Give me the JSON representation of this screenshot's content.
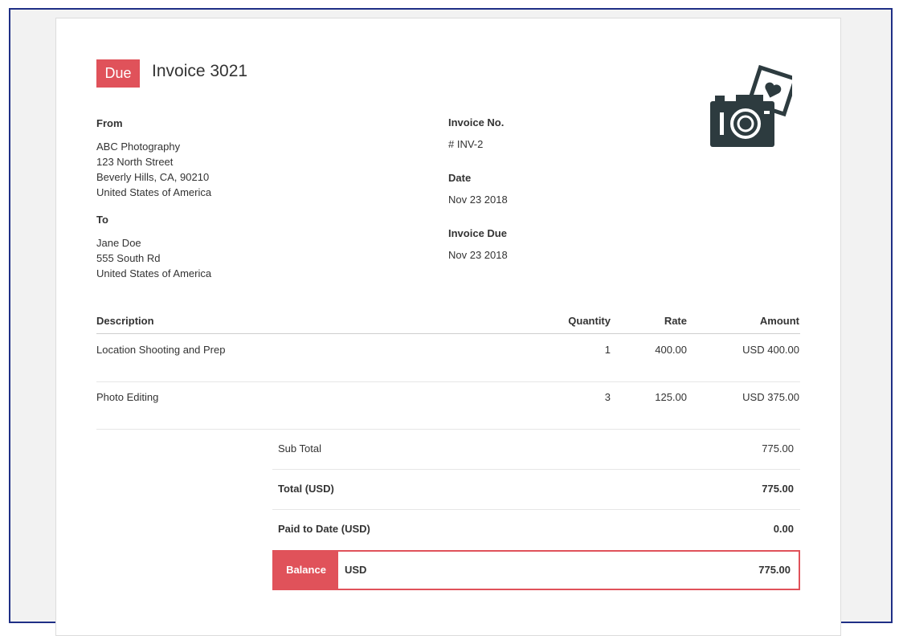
{
  "invoice": {
    "status": "Due",
    "title": "Invoice 3021",
    "logo_icon": "camera-photo-heart-icon"
  },
  "from": {
    "label": "From",
    "lines": [
      "ABC Photography",
      "123 North Street",
      "Beverly Hills, CA, 90210",
      "United States of America"
    ]
  },
  "to": {
    "label": "To",
    "lines": [
      "Jane Doe",
      "555 South Rd",
      "United States of America"
    ]
  },
  "meta": {
    "invoice_no_label": "Invoice No.",
    "invoice_no": "# INV-2",
    "date_label": "Date",
    "date": "Nov 23 2018",
    "due_label": "Invoice Due",
    "due": "Nov 23 2018"
  },
  "table": {
    "headers": [
      "Description",
      "Quantity",
      "Rate",
      "Amount"
    ],
    "rows": [
      {
        "description": "Location Shooting and Prep",
        "quantity": "1",
        "rate": "400.00",
        "amount": "USD 400.00"
      },
      {
        "description": "Photo Editing",
        "quantity": "3",
        "rate": "125.00",
        "amount": "USD 375.00"
      }
    ]
  },
  "summary": {
    "subtotal_label": "Sub Total",
    "subtotal": "775.00",
    "total_label": "Total (USD)",
    "total": "775.00",
    "paid_label": "Paid to Date (USD)",
    "paid": "0.00",
    "balance_label": "Balance",
    "balance_currency": "USD",
    "balance": "775.00"
  },
  "colors": {
    "accent": "#e0525a",
    "frame_border": "#1f2f86",
    "text": "#333333",
    "logo": "#2d3b3f"
  }
}
